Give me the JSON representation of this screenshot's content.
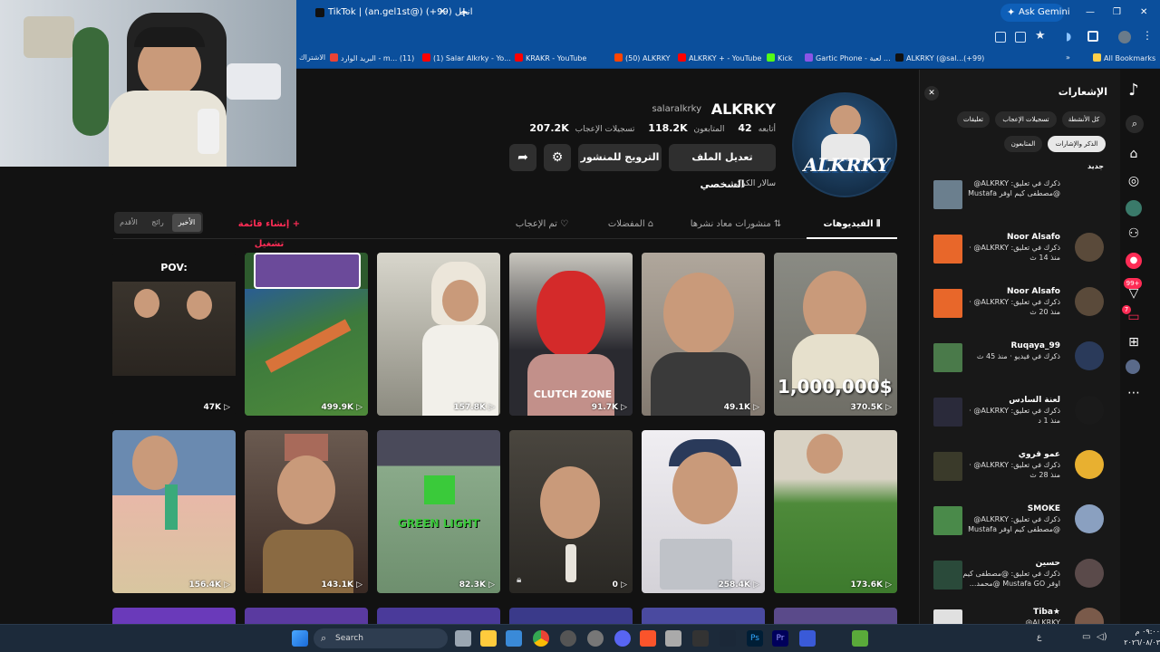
{
  "browser": {
    "active_tab": "TikTok | (an.gel1st@) انجل (99+)",
    "new_tab_symbol": "+",
    "ask_gemini": "Ask Gemini",
    "bookmarks": [
      {
        "label": "All Bookmarks",
        "color": "#ffd04a"
      },
      {
        "label": "ALKRKY (@sal...(+99)",
        "color": "#111111"
      },
      {
        "label": "Gartic Phone - لعبة ...",
        "color": "#8b55e6"
      },
      {
        "label": "Kick",
        "color": "#53fc18"
      },
      {
        "label": "ALKRKY + - YouTube",
        "color": "#ff0000"
      },
      {
        "label": "(50) ALKRKY",
        "color": "#ff4500"
      },
      {
        "label": "KRAKR - YouTube",
        "color": "#ff0000"
      },
      {
        "label": "(1) Salar Alkrky - Yo...",
        "color": "#ff0000"
      },
      {
        "label": "البريد الوارد - m... (11)",
        "color": "#ea4335"
      },
      {
        "label": "الاشتراك",
        "color": "#ff0000"
      }
    ]
  },
  "profile": {
    "display_name": "ALKRKY",
    "username": "salaralkrky",
    "following_label": "أتابعه",
    "following_count": "42",
    "followers_label": "المتابعون",
    "followers_count": "118.2K",
    "likes_label": "تسجيلات الإعجاب",
    "likes_count": "207.2K",
    "edit_profile": "تعديل الملف الشخصي",
    "promote_post": "الترويج للمنشور",
    "bio": "سالار الكركي",
    "avatar_text": "ALKRKY"
  },
  "tabs": {
    "videos": "الفيديوهات",
    "reposts": "منشورات معاد نشرها",
    "favorites": "المفضلات",
    "liked": "تم الإعجاب",
    "create_playlist": "إنشاء قائمة تشغيل",
    "sort_latest": "الأخير",
    "sort_popular": "رائج",
    "sort_oldest": "الأقدم"
  },
  "videos_row1": [
    {
      "views": "370.5K",
      "overlay": "1,000,000$",
      "bg": "#8a8b84"
    },
    {
      "views": "49.1K",
      "overlay": "",
      "bg": "#9b8f86"
    },
    {
      "views": "91.7K",
      "overlay": "CLUTCH ZONE",
      "bg": "#3a3840"
    },
    {
      "views": "157.8K",
      "overlay": "",
      "bg": "#c9c6b8"
    },
    {
      "views": "499.9K",
      "overlay": "",
      "bg": "#3b6b3a"
    },
    {
      "views": "47K",
      "overlay": "POV:",
      "bg": "#1a1a1a"
    }
  ],
  "videos_row2": [
    {
      "views": "173.6K",
      "overlay": "",
      "bg": "#4e8a3a"
    },
    {
      "views": "258.4K",
      "overlay": "",
      "bg": "#e7e7ea"
    },
    {
      "views": "0",
      "overlay": "",
      "bg": "#3d3a35"
    },
    {
      "views": "82.3K",
      "overlay": "GREEN LIGHT",
      "bg": "#6e8f6e"
    },
    {
      "views": "143.1K",
      "overlay": "",
      "bg": "#5a3e2e"
    },
    {
      "views": "156.4K",
      "overlay": "",
      "bg": "#d9c6b0"
    }
  ],
  "notifications": {
    "title": "الإشعارات",
    "filters": [
      "كل الأنشطة",
      "تسجيلات الإعجاب",
      "تعليقات",
      "الذكر والإشارات",
      "المتابعون"
    ],
    "section": "جديد",
    "items": [
      {
        "name": "",
        "line1": "ذكرك في تعليق: ALKRKY@",
        "line2": "@مصطفى كيم اوفر Mustafa",
        "time": "",
        "thumb": "#6b7f8e",
        "avatar": ""
      },
      {
        "name": "Noor Alsafo",
        "line1": "ذكرك في تعليق: ALKRKY@ ·",
        "line2": "",
        "time": "منذ 14 ث",
        "thumb": "#e8672a",
        "avatar": "#5a4a3a"
      },
      {
        "name": "Noor Alsafo",
        "line1": "ذكرك في تعليق: ALKRKY@ ·",
        "line2": "",
        "time": "منذ 20 ث",
        "thumb": "#e8672a",
        "avatar": "#5a4a3a"
      },
      {
        "name": "Ruqaya_99",
        "line1": "ذكرك في فيديو · منذ 45 ث",
        "line2": "",
        "time": "",
        "thumb": "#4a7a4a",
        "avatar": "#2a3a5a"
      },
      {
        "name": "لعنة السادس",
        "line1": "ذكرك في تعليق: ALKRKY@ ·",
        "line2": "",
        "time": "منذ 1 د",
        "thumb": "#2a2a3a",
        "avatar": "#1a1a1a"
      },
      {
        "name": "عمو قروي",
        "line1": "ذكرك في تعليق: ALKRKY@ ·",
        "line2": "",
        "time": "منذ 28 ث",
        "thumb": "#3a3a2a",
        "avatar": "#e8b030"
      },
      {
        "name": "SMOKE",
        "line1": "ذكرك في تعليق: ALKRKY@",
        "line2": "@مصطفى كيم اوفر Mustafa",
        "time": "",
        "thumb": "#4a8a4a",
        "avatar": "#8aa0c0"
      },
      {
        "name": "حسين",
        "line1": "ذكرك في تعليق: @مصطفى كيم",
        "line2": "اوفر Mustafa GO @محمد...",
        "time": "",
        "thumb": "#2a4a3a",
        "avatar": "#5a4a4a"
      },
      {
        "name": "★Tiba",
        "line1": "ALKRKY@",
        "line2": "",
        "time": "",
        "thumb": "#e0e0e0",
        "avatar": "#7a5a4a"
      }
    ]
  },
  "rail_badges": {
    "messages": "7",
    "activity": "99+"
  },
  "taskbar": {
    "search": "Search",
    "time": "٠٩:٠٠ م",
    "date": "٢٠٢٦/٠٨/٠٣",
    "lang": "ع"
  }
}
